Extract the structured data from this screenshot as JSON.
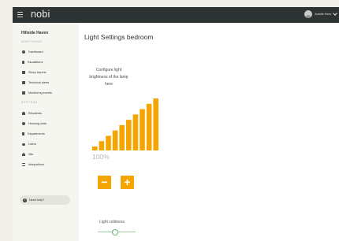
{
  "app": {
    "logo": "nobi"
  },
  "header": {
    "user_name": "Aurelie Hens"
  },
  "sidebar": {
    "org_name": "Hillside Haven",
    "sections": [
      {
        "title": "MONITORING",
        "items": [
          {
            "label": "Dashboard",
            "icon": "dashboard-icon"
          },
          {
            "label": "Escalations",
            "icon": "escalations-icon"
          },
          {
            "label": "Sleep reports",
            "icon": "sleep-reports-icon"
          },
          {
            "label": "Technical alerts",
            "icon": "technical-alerts-icon"
          },
          {
            "label": "Monitoring events",
            "icon": "monitoring-events-icon"
          }
        ]
      },
      {
        "title": "SETTINGS",
        "items": [
          {
            "label": "Residents",
            "icon": "residents-icon"
          },
          {
            "label": "Housing units",
            "icon": "housing-units-icon"
          },
          {
            "label": "Departments",
            "icon": "departments-icon"
          },
          {
            "label": "Users",
            "icon": "users-icon"
          },
          {
            "label": "Site",
            "icon": "site-icon"
          },
          {
            "label": "Integrations",
            "icon": "integrations-icon"
          }
        ]
      }
    ],
    "help_label": "Need help?"
  },
  "main": {
    "title": "Light Settings bedroom",
    "instruction": "Configure light brightness of the lamp here",
    "brightness": {
      "value": 1.0,
      "levels": 10,
      "label": "100%"
    },
    "colors": {
      "accent": "#f5a500",
      "slider": "#6db574"
    },
    "light_coldness": {
      "label": "Light coldness",
      "value": 0.45
    }
  }
}
